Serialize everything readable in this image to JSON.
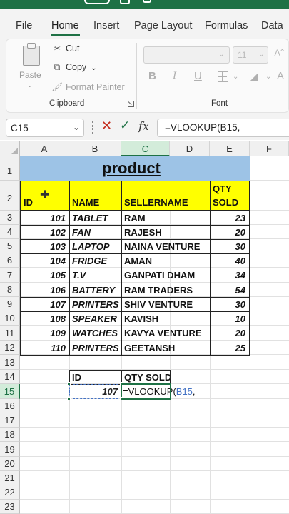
{
  "ribbon": {
    "tabs": [
      "File",
      "Home",
      "Insert",
      "Page Layout",
      "Formulas",
      "Data"
    ],
    "active_tab": "Home",
    "clipboard": {
      "paste": "Paste",
      "cut": "Cut",
      "copy": "Copy",
      "format_painter": "Format Painter",
      "group_label": "Clipboard"
    },
    "font": {
      "size": "11",
      "group_label": "Font",
      "bold": "B",
      "italic": "I",
      "underline": "U"
    }
  },
  "formula_bar": {
    "name_box": "C15",
    "fx": "fx",
    "formula": "=VLOOKUP(B15,"
  },
  "columns": [
    "A",
    "B",
    "C",
    "D",
    "E",
    "F"
  ],
  "selected_column": "C",
  "rows": [
    "1",
    "2",
    "3",
    "4",
    "5",
    "6",
    "7",
    "8",
    "9",
    "10",
    "11",
    "12",
    "13",
    "14",
    "15",
    "16",
    "17",
    "18",
    "19",
    "20",
    "21",
    "22",
    "23"
  ],
  "selected_row": "15",
  "sheet": {
    "title": "product",
    "headers": {
      "id": "ID",
      "name": "NAME",
      "seller": "SELLERNAME",
      "qty_line1": "QTY",
      "qty_line2": "SOLD"
    },
    "records": [
      {
        "id": "101",
        "name": "TABLET",
        "seller": "RAM",
        "qty": "23"
      },
      {
        "id": "102",
        "name": "FAN",
        "seller": "RAJESH",
        "qty": "20"
      },
      {
        "id": "103",
        "name": "LAPTOP",
        "seller": "NAINA VENTURE",
        "qty": "30"
      },
      {
        "id": "104",
        "name": "FRIDGE",
        "seller": "AMAN",
        "qty": "40"
      },
      {
        "id": "105",
        "name": "T.V",
        "seller": "GANPATI DHAM",
        "qty": "34"
      },
      {
        "id": "106",
        "name": "BATTERY",
        "seller": "RAM TRADERS",
        "qty": "54"
      },
      {
        "id": "107",
        "name": "PRINTERS",
        "seller": "SHIV VENTURE",
        "qty": "30"
      },
      {
        "id": "108",
        "name": "SPEAKER",
        "seller": "KAVISH",
        "qty": "10"
      },
      {
        "id": "109",
        "name": "WATCHES",
        "seller": "KAVYA VENTURE",
        "qty": "20"
      },
      {
        "id": "110",
        "name": "PRINTERS",
        "seller": "GEETANSH",
        "qty": "25"
      }
    ],
    "lookup": {
      "id_header": "ID",
      "qty_header": "QTY SOLD",
      "id_value": "107",
      "formula_prefix": "=VLOOKUP(",
      "formula_ref": "B15",
      "formula_suffix": ","
    }
  },
  "colors": {
    "accent": "#1e7145",
    "title_fill": "#9dc3e6",
    "header_fill": "#ffff00",
    "ref_blue": "#4472c4"
  }
}
